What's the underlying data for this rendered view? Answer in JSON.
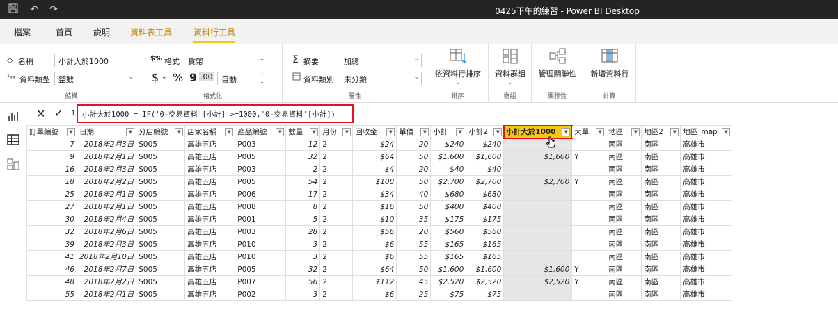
{
  "window": {
    "title": "0425下午的練習 - Power BI Desktop"
  },
  "tabs": [
    {
      "label": "檔案"
    },
    {
      "label": "首頁"
    },
    {
      "label": "説明"
    },
    {
      "label": "資料表工具"
    },
    {
      "label": "資料行工具"
    }
  ],
  "ribbon": {
    "structure": {
      "name_label": "名稱",
      "name_value": "小計大於1000",
      "type_label": "資料類型",
      "type_value": "整數",
      "group": "結構"
    },
    "formatting": {
      "format_label": "格式",
      "format_value": "貨幣",
      "currency": "$",
      "percent": "%",
      "comma": "9",
      "decimal_value": "自動",
      "group": "格式化"
    },
    "properties": {
      "summarize_label": "摘要",
      "summarize_value": "加總",
      "category_label": "資料類別",
      "category_value": "未分類",
      "group": "屬性"
    },
    "sort": {
      "label": "依資料行排序",
      "group": "排序"
    },
    "groups": {
      "label": "資料群組",
      "group": "群組"
    },
    "relationships": {
      "label": "管理關聯性",
      "group": "關聯性"
    },
    "calculations": {
      "label": "新增資料行",
      "group": "計算"
    }
  },
  "formula": {
    "line": "1",
    "text": "小計大於1000 = IF('0-交易資料'[小計] >=1000,'0-交易資料'[小計])"
  },
  "table": {
    "headers": [
      "訂單編號",
      "日期",
      "分店編號",
      "店家名稱",
      "產品編號",
      "數量",
      "月份",
      "回收金",
      "單價",
      "小計",
      "小計2",
      "小計大於1000",
      "大單",
      "地區",
      "地區2",
      "地區_map"
    ],
    "rows": [
      [
        "7",
        "2018年2月3日",
        "S005",
        "高雄五店",
        "P003",
        "12",
        "2",
        "$24",
        "20",
        "$240",
        "$240",
        "",
        "",
        "南區",
        "南區",
        "高雄市"
      ],
      [
        "9",
        "2018年2月1日",
        "S005",
        "高雄五店",
        "P005",
        "32",
        "2",
        "$64",
        "50",
        "$1,600",
        "$1,600",
        "$1,600",
        "Y",
        "南區",
        "南區",
        "高雄市"
      ],
      [
        "16",
        "2018年2月3日",
        "S005",
        "高雄五店",
        "P003",
        "2",
        "2",
        "$4",
        "20",
        "$40",
        "$40",
        "",
        "",
        "南區",
        "南區",
        "高雄市"
      ],
      [
        "18",
        "2018年2月2日",
        "S005",
        "高雄五店",
        "P005",
        "54",
        "2",
        "$108",
        "50",
        "$2,700",
        "$2,700",
        "$2,700",
        "Y",
        "南區",
        "南區",
        "高雄市"
      ],
      [
        "25",
        "2018年2月1日",
        "S005",
        "高雄五店",
        "P006",
        "17",
        "2",
        "$34",
        "40",
        "$680",
        "$680",
        "",
        "",
        "南區",
        "南區",
        "高雄市"
      ],
      [
        "27",
        "2018年2月1日",
        "S005",
        "高雄五店",
        "P008",
        "8",
        "2",
        "$16",
        "50",
        "$400",
        "$400",
        "",
        "",
        "南區",
        "南區",
        "高雄市"
      ],
      [
        "30",
        "2018年2月4日",
        "S005",
        "高雄五店",
        "P001",
        "5",
        "2",
        "$10",
        "35",
        "$175",
        "$175",
        "",
        "",
        "南區",
        "南區",
        "高雄市"
      ],
      [
        "32",
        "2018年2月6日",
        "S005",
        "高雄五店",
        "P003",
        "28",
        "2",
        "$56",
        "20",
        "$560",
        "$560",
        "",
        "",
        "南區",
        "南區",
        "高雄市"
      ],
      [
        "39",
        "2018年2月3日",
        "S005",
        "高雄五店",
        "P010",
        "3",
        "2",
        "$6",
        "55",
        "$165",
        "$165",
        "",
        "",
        "南區",
        "南區",
        "高雄市"
      ],
      [
        "41",
        "2018年2月10日",
        "S005",
        "高雄五店",
        "P010",
        "3",
        "2",
        "$6",
        "55",
        "$165",
        "$165",
        "",
        "",
        "南區",
        "南區",
        "高雄市"
      ],
      [
        "46",
        "2018年2月7日",
        "S005",
        "高雄五店",
        "P005",
        "32",
        "2",
        "$64",
        "50",
        "$1,600",
        "$1,600",
        "$1,600",
        "Y",
        "南區",
        "南區",
        "高雄市"
      ],
      [
        "48",
        "2018年2月2日",
        "S005",
        "高雄五店",
        "P007",
        "56",
        "2",
        "$112",
        "45",
        "$2,520",
        "$2,520",
        "$2,520",
        "Y",
        "南區",
        "南區",
        "高雄市"
      ],
      [
        "55",
        "2018年2月1日",
        "S005",
        "高雄五店",
        "P002",
        "3",
        "2",
        "$6",
        "25",
        "$75",
        "$75",
        "",
        "",
        "南區",
        "南區",
        "高雄市"
      ]
    ]
  },
  "colors": {
    "accent": "#f2c811",
    "highlight": "#e81123",
    "titlebar": "#252423"
  },
  "icons": [
    "save-icon",
    "undo-icon",
    "redo-icon",
    "tag-icon",
    "data-type-icon",
    "format-icon",
    "sigma-icon",
    "category-icon",
    "sort-icon",
    "groups-icon",
    "relationships-icon",
    "new-column-icon",
    "report-view-icon",
    "data-view-icon",
    "model-view-icon",
    "cancel-icon",
    "commit-icon",
    "cursor-icon"
  ]
}
